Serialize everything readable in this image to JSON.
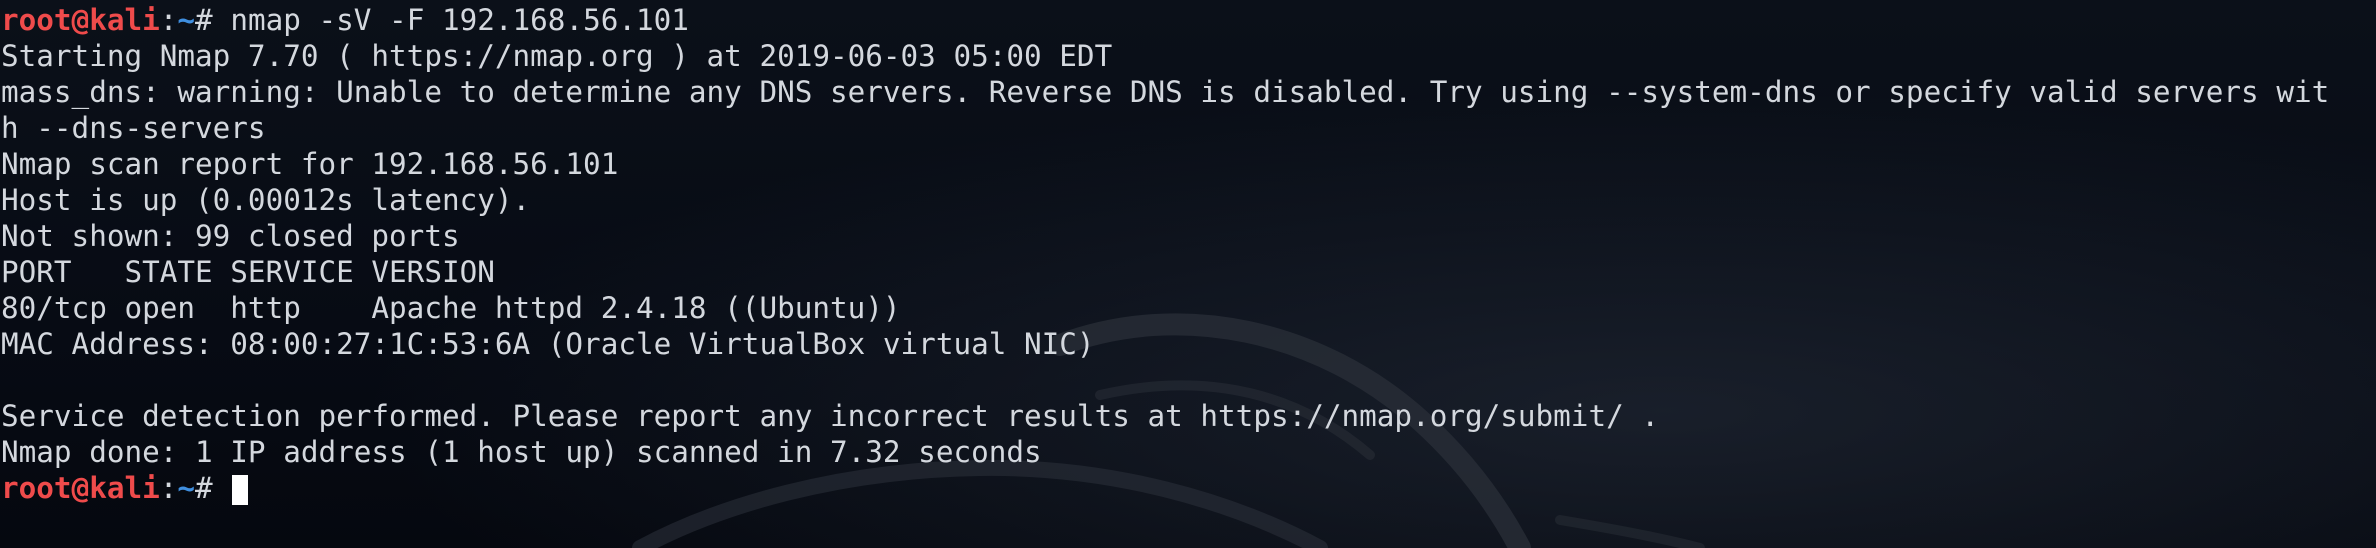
{
  "prompt": {
    "user_host": "root@kali",
    "separator": ":",
    "path": "~",
    "symbol": "# "
  },
  "command": "nmap -sV -F 192.168.56.101",
  "output_lines": [
    "Starting Nmap 7.70 ( https://nmap.org ) at 2019-06-03 05:00 EDT",
    "mass_dns: warning: Unable to determine any DNS servers. Reverse DNS is disabled. Try using --system-dns or specify valid servers wit",
    "h --dns-servers",
    "Nmap scan report for 192.168.56.101",
    "Host is up (0.00012s latency).",
    "Not shown: 99 closed ports",
    "PORT   STATE SERVICE VERSION",
    "80/tcp open  http    Apache httpd 2.4.18 ((Ubuntu))",
    "MAC Address: 08:00:27:1C:53:6A (Oracle VirtualBox virtual NIC)",
    "",
    "Service detection performed. Please report any incorrect results at https://nmap.org/submit/ .",
    "Nmap done: 1 IP address (1 host up) scanned in 7.32 seconds"
  ],
  "colors": {
    "background": "#070b14",
    "text": "#d4d8de",
    "prompt_user": "#ef4b4b",
    "prompt_path": "#3f8fe0",
    "cursor": "#ffffff"
  },
  "icons": {
    "background": "kali-dragon-logo-icon",
    "cursor": "block-cursor"
  }
}
